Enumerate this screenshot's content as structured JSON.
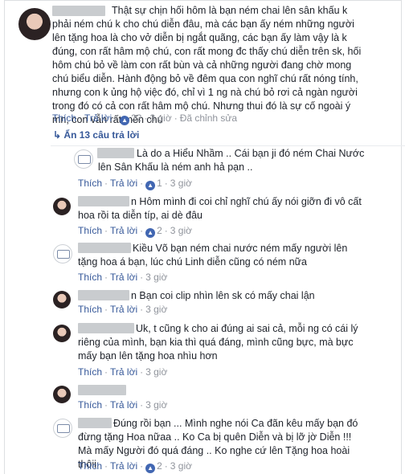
{
  "main_comment": {
    "text": "Thật sự chịn hối hôm là bạn ném chai lên sân khấu k phải ném chú k cho chú diễn đâu, mà các bạn ấy ném những người lên tặng hoa là cho vở diễn bị ngắt quãng, các bạn ấy làm vậy là k đúng, con rất hâm mộ chú, con rất mong đc thấy chú diễn trên sk, hối hôm chú bỏ về làm con rất bùn và cả những người đang chờ mong chú biểu diễn. Hành động bỏ về đêm qua con nghĩ chú rất nóng tính, nhưng con k ủng hộ việc đó, chỉ vì 1 ng nà chú bỏ rơi cả ngàn người trong đó có cả con rất hâm mộ chú. Nhưng thui đó là sự cố ngoài ý mn, con vẫn rất mến chú",
    "like_label": "Thích",
    "reply_label": "Trả lời",
    "like_count": "22",
    "time": "3 giờ",
    "edited": "Đã chỉnh sửa"
  },
  "replies_toggle": "Ẩn 13 câu trả lời",
  "replies": [
    {
      "avatar": "stamp",
      "text": "Là do a Hiểu Nhầm .. Cái bạn ji đó ném Chai Nước lên Sân Khấu là ném anh hả pạn ..",
      "like_label": "Thích",
      "reply_label": "Trả lời",
      "like_count": "1",
      "time": "3 giờ"
    },
    {
      "avatar": "girl",
      "text": "n Hôm mình đi coi chỉ nghĩ chú ấy nói giỡn đi vô cất hoa rồi ta diễn típ, ai dè đâu",
      "like_label": "Thích",
      "reply_label": "Trả lời",
      "like_count": "2",
      "time": "3 giờ"
    },
    {
      "avatar": "stamp",
      "text": "Kiều Võ bạn ném chai nước ném mấy người lên tặng hoa á bạn, lúc chú Linh diễn cũng có ném nữa",
      "like_label": "Thích",
      "reply_label": "Trả lời",
      "time": "3 giờ"
    },
    {
      "avatar": "girl",
      "text": "n Bạn coi clip nhìn lên sk có mấy chai lận",
      "like_label": "Thích",
      "reply_label": "Trả lời",
      "time": "3 giờ"
    },
    {
      "avatar": "girl2",
      "text": "Uk, t cũng k cho ai đúng ai sai cả, mỗi ng có cái lý riêng của mình, bạn kia thì quá đáng, mình cũng bực, mà bực mấy bạn lên tặng hoa nhìu hơn",
      "like_label": "Thích",
      "reply_label": "Trả lời",
      "time": "3 giờ"
    },
    {
      "avatar": "girl",
      "text": "",
      "like_label": "Thích",
      "reply_label": "Trả lời",
      "time": "3 giờ"
    },
    {
      "avatar": "stamp",
      "text": "Đúng rồi bạn ... Mình nghe nói Ca đãn kêu mấy bạn đó đừng tặng Hoa nữaa .. Ko Ca bị quên Diễn và bị lỡ jờ Diễn !!! Mà mấy Người đó quá đáng .. Ko nghe cứ lên Tặng hoa hoài thôii",
      "like_label": "Thích",
      "reply_label": "Trả lời",
      "like_count": "2",
      "time": "3 giờ"
    }
  ],
  "colors": {
    "link": "#365899",
    "meta": "#90949c",
    "text": "#1d2129",
    "like_badge": "#4267b2"
  }
}
